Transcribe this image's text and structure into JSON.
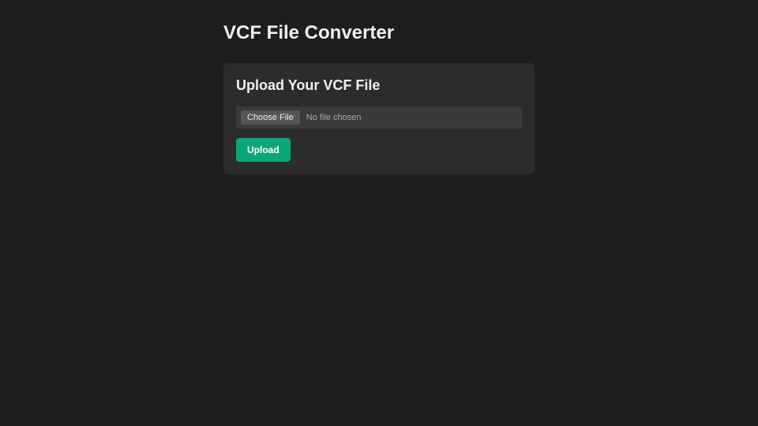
{
  "page": {
    "title": "VCF File Converter"
  },
  "card": {
    "title": "Upload Your VCF File",
    "file_input": {
      "button_label": "Choose File",
      "status_text": "No file chosen"
    },
    "upload_button_label": "Upload"
  }
}
